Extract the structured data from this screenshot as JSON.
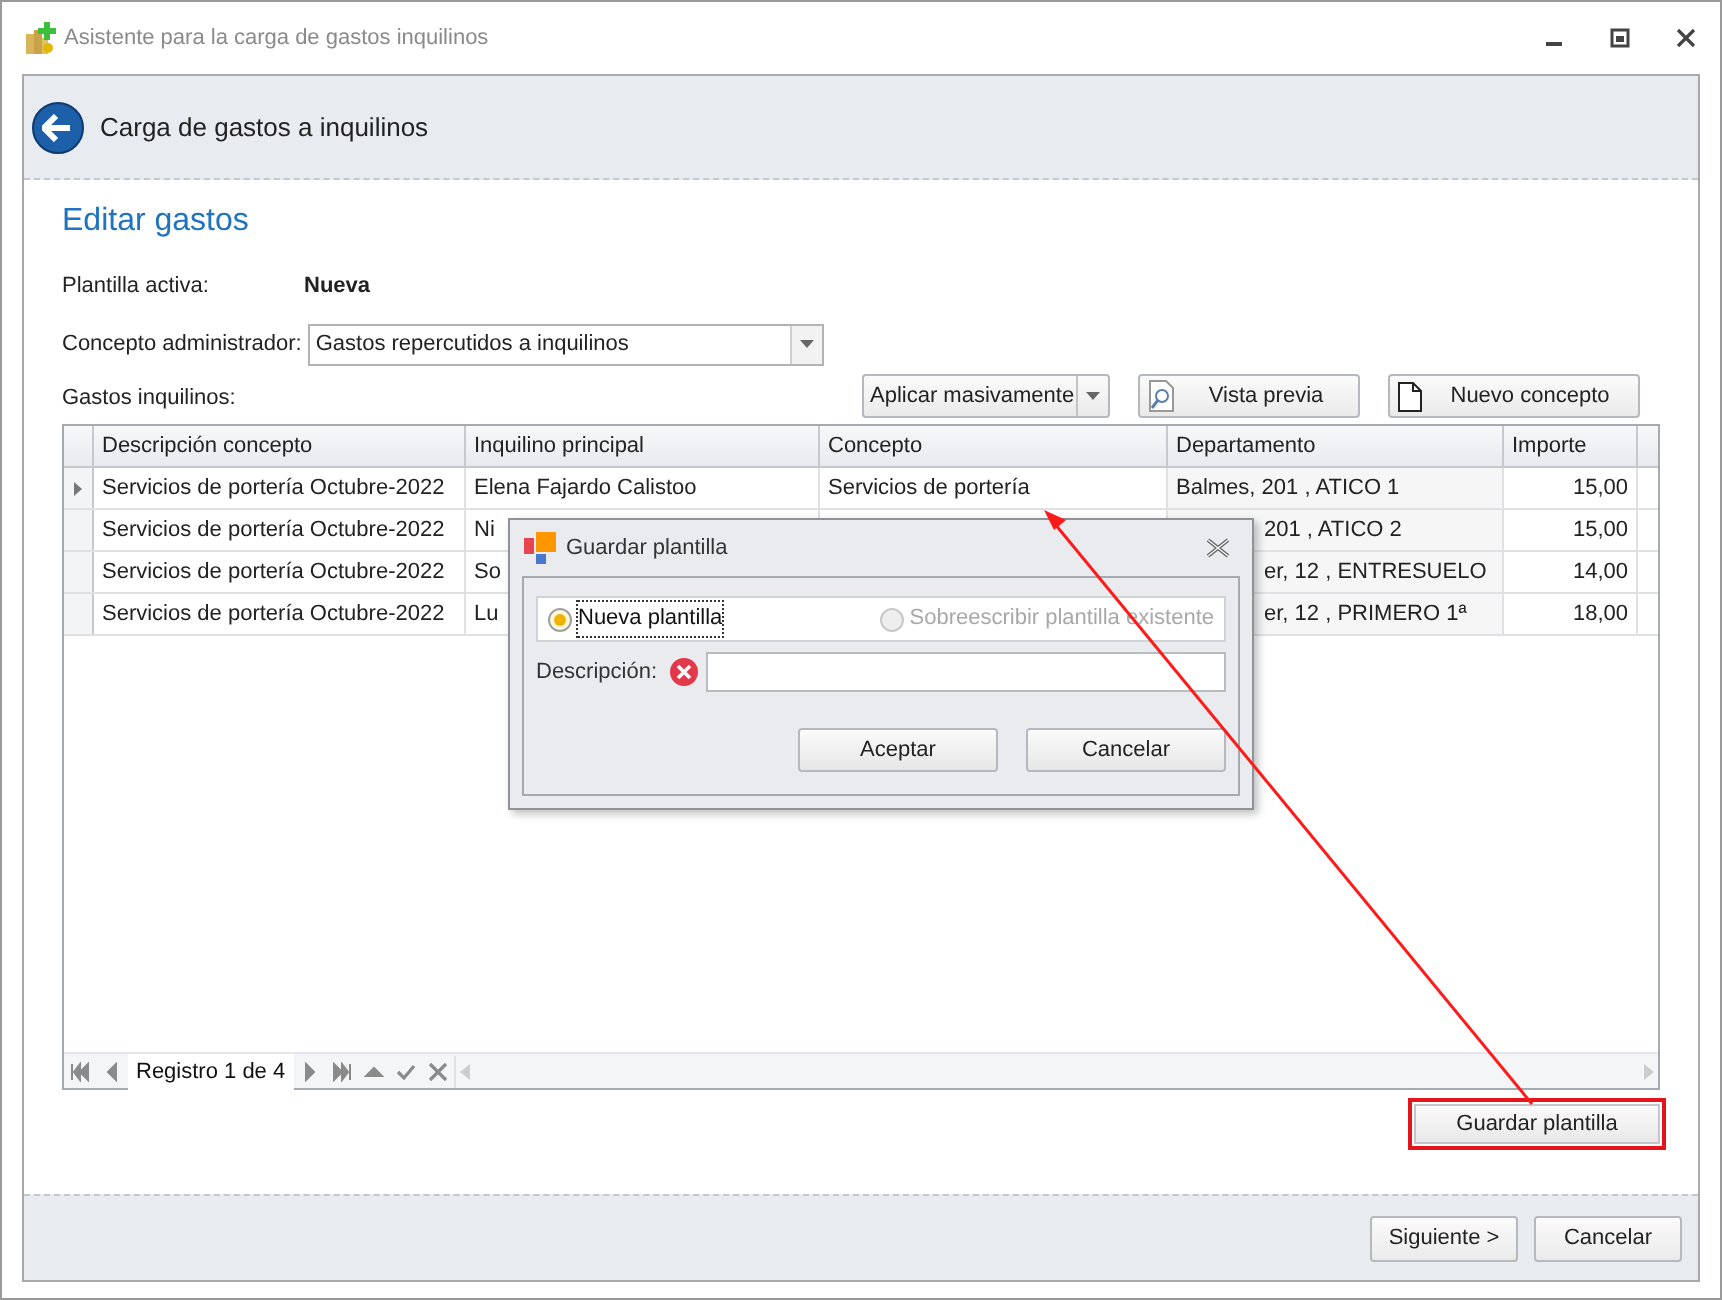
{
  "window": {
    "title": "Asistente para la carga de gastos inquilinos"
  },
  "header": {
    "title": "Carga de gastos a inquilinos"
  },
  "section_title": "Editar gastos",
  "active_template": {
    "label": "Plantilla activa:",
    "value": "Nueva"
  },
  "admin_concept": {
    "label": "Concepto administrador:",
    "value": "Gastos repercutidos a inquilinos"
  },
  "grid_label": "Gastos inquilinos:",
  "toolbar": [
    {
      "kind": "split",
      "label": "Aplicar masivamente"
    },
    {
      "kind": "preview",
      "label": "Vista previa"
    },
    {
      "kind": "new",
      "label": "Nuevo concepto"
    }
  ],
  "table": {
    "columns": [
      "Descripción concepto",
      "Inquilino principal",
      "Concepto",
      "Departamento",
      "Importe"
    ],
    "rows": [
      {
        "selected": true,
        "descripcion": "Servicios de portería Octubre-2022",
        "inquilino": "Elena Fajardo Calistoo",
        "concepto": "Servicios de portería",
        "departamento": "Balmes, 201 , ATICO 1",
        "importe": "15,00"
      },
      {
        "selected": false,
        "descripcion": "Servicios de portería Octubre-2022",
        "inquilino": "Ni",
        "departamento": "201 , ATICO 2",
        "importe": "15,00"
      },
      {
        "selected": false,
        "descripcion": "Servicios de portería Octubre-2022",
        "inquilino": "So",
        "departamento": "er, 12 , ENTRESUELO",
        "importe": "14,00"
      },
      {
        "selected": false,
        "descripcion": "Servicios de portería Octubre-2022",
        "inquilino": "Lu",
        "departamento": "er, 12 , PRIMERO 1ª",
        "importe": "18,00"
      }
    ]
  },
  "navigator": {
    "record": "Registro 1 de 4"
  },
  "save_template_button": "Guardar plantilla",
  "dialog": {
    "title": "Guardar plantilla",
    "options": [
      {
        "label": "Nueva plantilla",
        "selected": true,
        "disabled": false
      },
      {
        "label": "Sobreescribir plantilla existente",
        "selected": false,
        "disabled": true
      }
    ],
    "description": {
      "label": "Descripción:",
      "error": true
    },
    "buttons": [
      "Aceptar",
      "Cancelar"
    ]
  },
  "footer_buttons": [
    "Siguiente >",
    "Cancelar"
  ]
}
